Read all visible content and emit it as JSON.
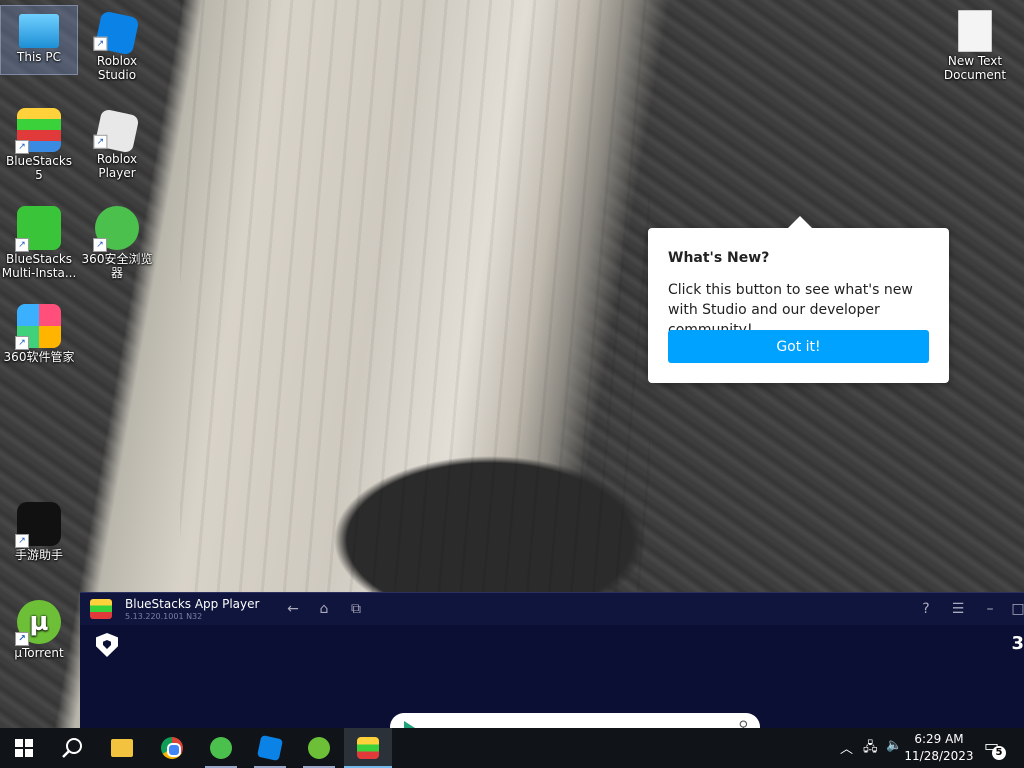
{
  "desktop": {
    "icons": [
      {
        "label": "This PC"
      },
      {
        "label": "Roblox Studio"
      },
      {
        "label": "BlueStacks 5"
      },
      {
        "label": "Roblox Player"
      },
      {
        "label": "BlueStacks Multi-Insta..."
      },
      {
        "label": "360安全浏览器"
      },
      {
        "label": "360软件管家"
      },
      {
        "label": "手游助手"
      },
      {
        "label": "µTorrent"
      },
      {
        "label": "New Text Document"
      }
    ]
  },
  "popup": {
    "title": "What's New?",
    "body": "Click this button to see what's new with Studio and our developer community!",
    "button": "Got it!"
  },
  "bluestacks": {
    "title": "BlueStacks App Player",
    "version": "5.13.220.1001 N32",
    "edge_number": "3"
  },
  "taskbar": {
    "time": "6:29 AM",
    "date": "11/28/2023",
    "notification_count": "5"
  }
}
